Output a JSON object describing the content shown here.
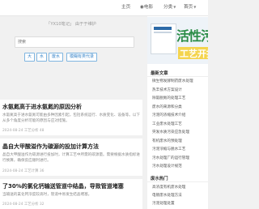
{
  "nav": [
    {
      "label": "主页",
      "caret": false
    },
    {
      "label": "电影",
      "caret": false
    },
    {
      "label": "分类",
      "caret": true
    },
    {
      "label": "首页",
      "caret": true
    }
  ],
  "notice": "「YX10笔记」 由于于维护",
  "search": {
    "text": "搜索"
  },
  "tags": [
    "大",
    "水",
    "废水"
  ],
  "tag_extra": "模糊有类代录",
  "articles": [
    {
      "title": "水氨氮高于进水氨氮的原因分析",
      "snippet": "水氨氮高于进水氨氮可能由多种因素引起，包括系统运行、水质变化、设备等。以下从多个角度分析可能的原因与应对措施。",
      "meta": "2024-08-24  工艺分析  48"
    },
    {
      "title": "晶自大甲酸溢作为碳源的投加计算方法",
      "snippet": "晶自大甲酸溢作为碳源进行投加时，计算工艺中所需的碳源量。需要根据水质指标进行换算，确保反应顺利进行。",
      "meta": "2024-08-24  工艺计算  36"
    },
    {
      "title": "了30%的氯化钙输送管道中结晶，导致管道堵塞",
      "snippet": "当输送的氯化钙浓度较高时，管道中易发生结晶堵塞。",
      "meta": "2024-08-24  工艺分析  32"
    }
  ],
  "banner": {
    "big": "活性污泥",
    "big2": "工艺开拓"
  },
  "sidebar": {
    "heading1": "最新文章",
    "items1": [
      "微生物发酵制药废水处理",
      "热丰技术方案设计",
      "除氨脱氮的处理工艺",
      "废水的来源和分类",
      "污泥的浓缩技术介绍",
      "工业废水处理工艺",
      "突发水质污染应急处理",
      "有机废水的预处理",
      "污泥浓缩与脱水工艺",
      "污水处理厂的运行管理",
      "污水处理设计规范"
    ],
    "heading2": "废水热门",
    "items2": [
      "高浓度有机废水处理",
      "电镀废水处理方法",
      "污泥处理处置"
    ]
  },
  "colors": {
    "accent": "#3a85c9",
    "banner_green": "#2a8c46",
    "banner_yellow": "#f4d44e"
  }
}
